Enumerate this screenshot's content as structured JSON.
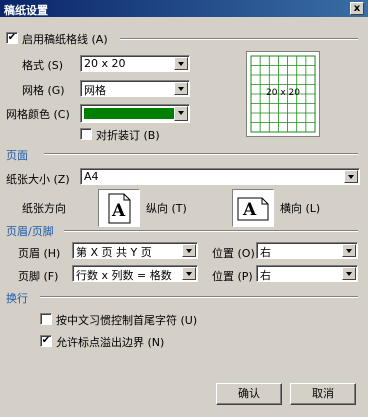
{
  "window": {
    "title": "稿纸设置",
    "close_label": "x"
  },
  "enable": {
    "label": "启用稿纸格线 (A)",
    "checked": true,
    "check_mark": "✔"
  },
  "format": {
    "label": "格式 (S)",
    "value": "20 x 20"
  },
  "grid": {
    "label": "网格 (G)",
    "value": "网格"
  },
  "grid_color": {
    "label": "网格颜色 (C)",
    "color": "#008000"
  },
  "fold": {
    "label": "对折装订 (B)",
    "checked": false
  },
  "preview": {
    "text": "20 x 20",
    "color": "#1a8a1a"
  },
  "page_section": {
    "title": "页面"
  },
  "paper_size": {
    "label": "纸张大小 (Z)",
    "value": "A4"
  },
  "orientation": {
    "label": "纸张方向",
    "portrait_label": "纵向 (T)",
    "landscape_label": "横向 (L)",
    "icon_letter": "A"
  },
  "header_footer_section": {
    "title": "页眉/页脚"
  },
  "header": {
    "label": "页眉 (H)",
    "value": "第 X 页 共 Y 页",
    "pos_label": "位置 (O)",
    "pos_value": "右"
  },
  "footer": {
    "label": "页脚 (F)",
    "value": "行数 x 列数 = 格数",
    "pos_label": "位置 (P)",
    "pos_value": "右"
  },
  "wrap_section": {
    "title": "换行"
  },
  "wrap_opt1": {
    "label": "按中文习惯控制首尾字符 (U)",
    "checked": false
  },
  "wrap_opt2": {
    "label": "允许标点溢出边界 (N)",
    "checked": true,
    "check_mark": "✔"
  },
  "buttons": {
    "ok": "确认",
    "cancel": "取消"
  }
}
